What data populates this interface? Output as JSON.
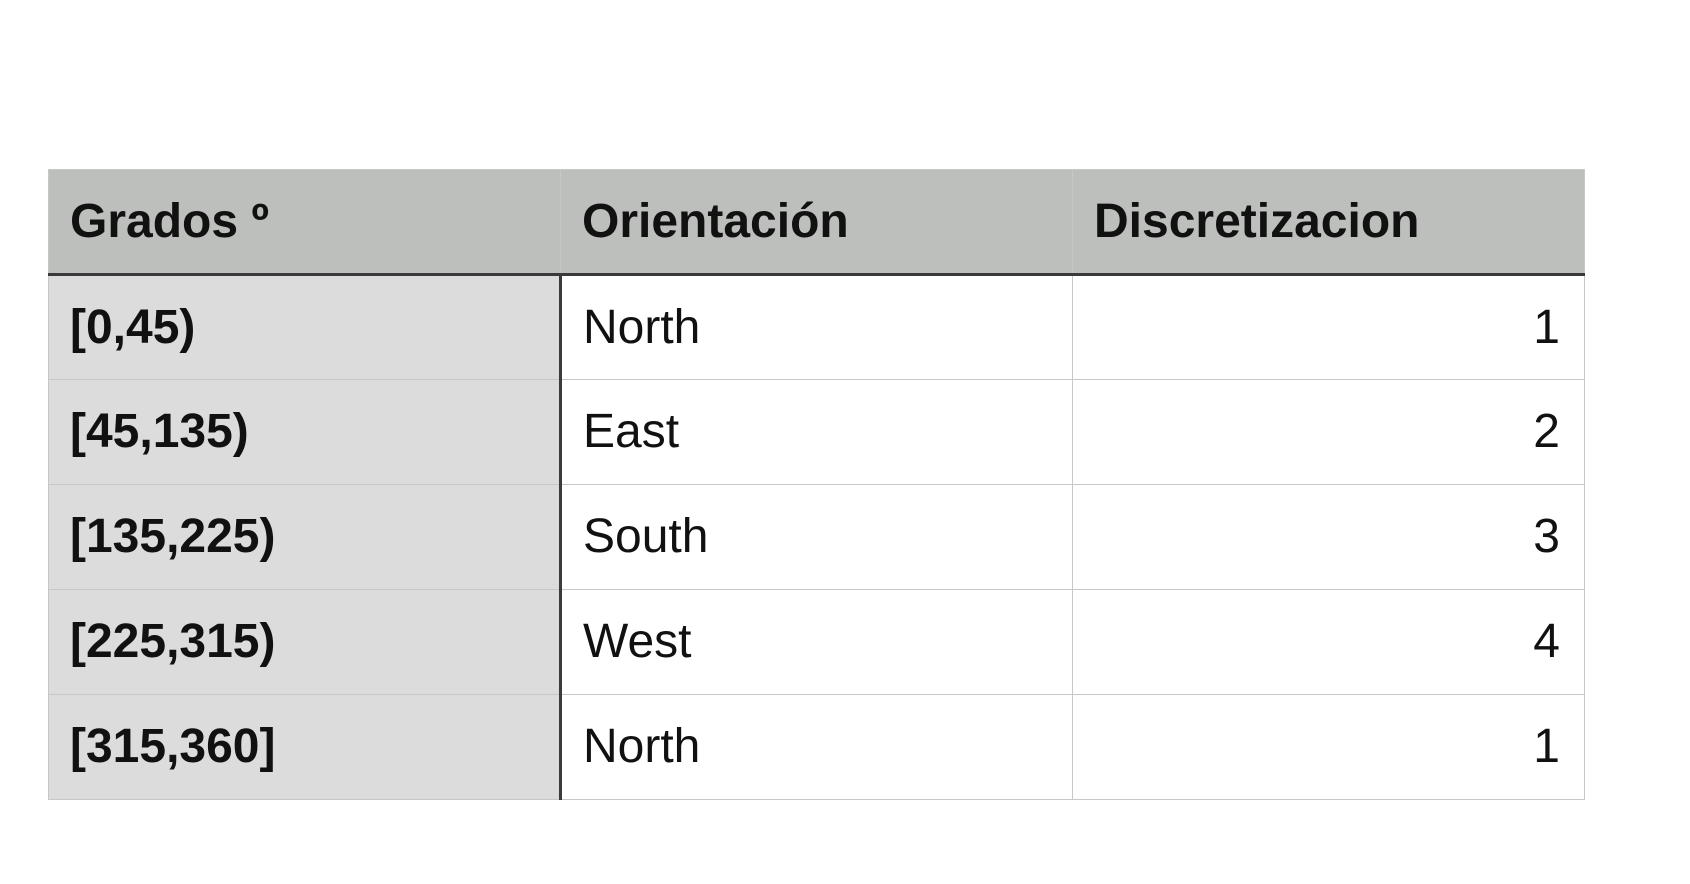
{
  "table": {
    "headers": [
      "Grados º",
      "Orientación",
      "Discretizacion"
    ],
    "rows": [
      {
        "grados": "[0,45)",
        "orientacion": "North",
        "discretizacion": "1"
      },
      {
        "grados": "[45,135)",
        "orientacion": "East",
        "discretizacion": "2"
      },
      {
        "grados": "[135,225)",
        "orientacion": "South",
        "discretizacion": "3"
      },
      {
        "grados": "[225,315)",
        "orientacion": "West",
        "discretizacion": "4"
      },
      {
        "grados": "[315,360]",
        "orientacion": "North",
        "discretizacion": "1"
      }
    ]
  },
  "colors": {
    "header_bg": "#bdbfbd",
    "row_header_bg": "#dcdcdc",
    "cell_bg": "#ffffff",
    "grid_line": "#c7c7c7",
    "divider": "#3a3a3a"
  }
}
